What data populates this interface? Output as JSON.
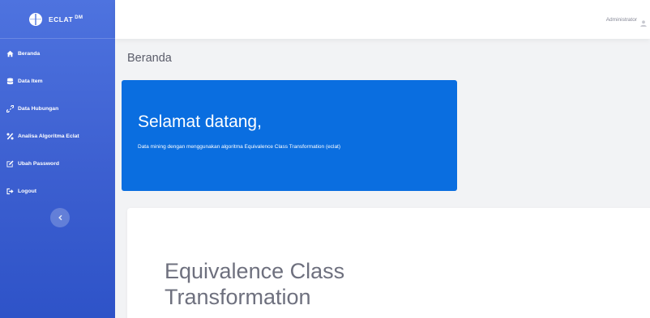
{
  "brand": {
    "name": "ECLAT",
    "suffix": "DM"
  },
  "sidebar": {
    "items": [
      {
        "label": "Beranda",
        "icon": "home-icon"
      },
      {
        "label": "Data Item",
        "icon": "database-icon"
      },
      {
        "label": "Data Hubungan",
        "icon": "link-icon"
      },
      {
        "label": "Analisa Algoritma Eclat",
        "icon": "percent-icon"
      },
      {
        "label": "Ubah Password",
        "icon": "edit-icon"
      },
      {
        "label": "Logout",
        "icon": "logout-icon"
      }
    ],
    "toggle_icon": "chevron-left-icon"
  },
  "topbar": {
    "user_name": "Administrator",
    "user_icon": "user-icon"
  },
  "main": {
    "page_title": "Beranda",
    "welcome": {
      "title": "Selamat datang,",
      "subtitle": "Data mining dengan menggunakan algoritma Equivalence Class Transformation (eclat)"
    },
    "hero_title": "Equivalence Class Transformation"
  },
  "colors": {
    "sidebar": "#4e73df",
    "welcome_card": "#0a6ee0",
    "background": "#f2f3f5"
  }
}
